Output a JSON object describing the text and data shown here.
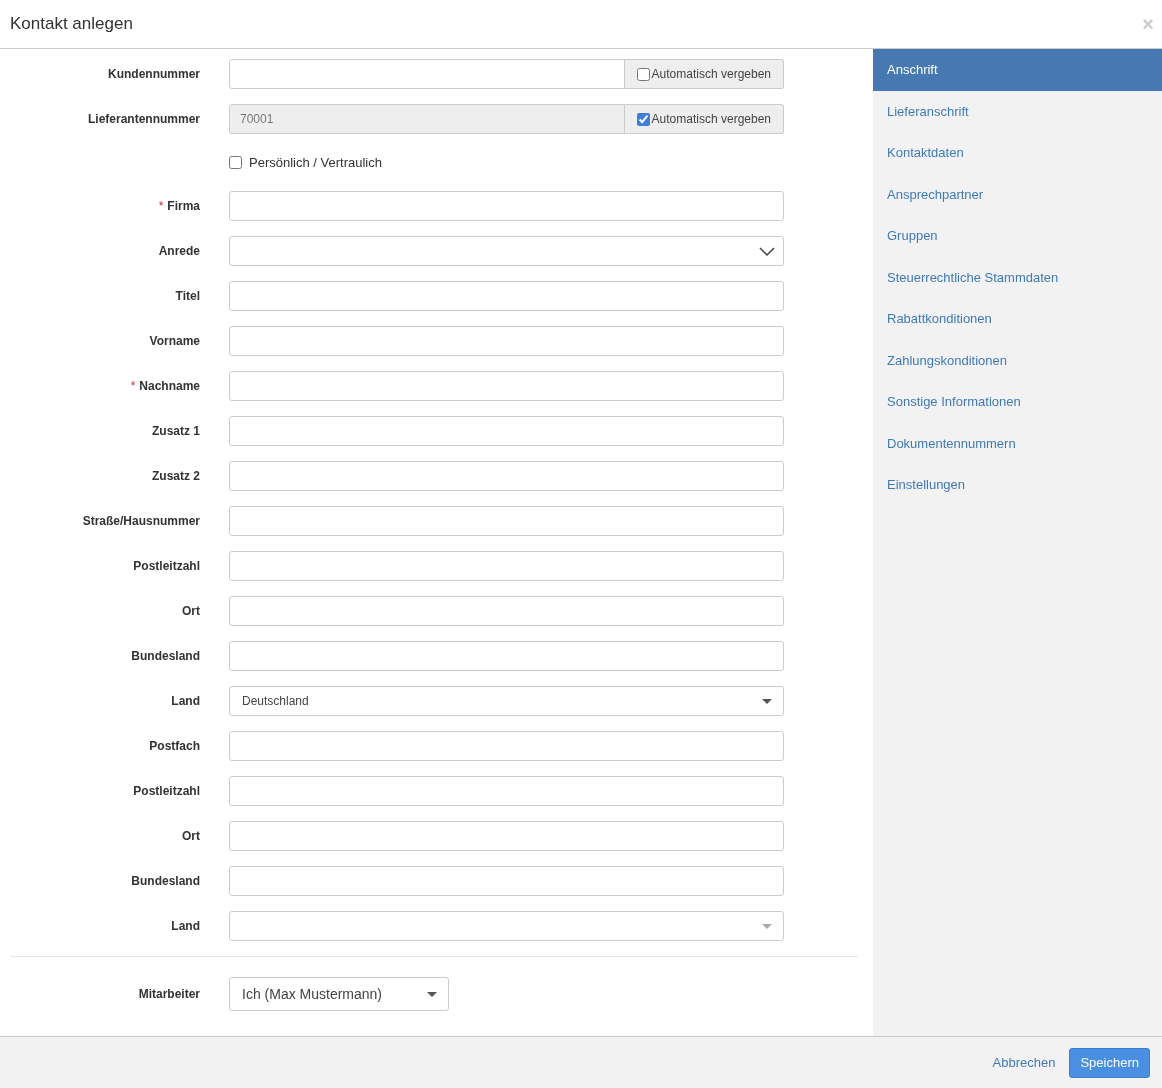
{
  "dialog": {
    "title": "Kontakt anlegen",
    "close": "×"
  },
  "fields": [
    {
      "kind": "addon",
      "label": "Kundennummer",
      "disabled": false,
      "addon": {
        "label": "Automatisch vergeben",
        "checked": false
      }
    },
    {
      "kind": "addon",
      "label": "Lieferantennummer",
      "disabled": true,
      "value": "70001",
      "addon": {
        "label": "Automatisch vergeben",
        "checked": true
      }
    },
    {
      "kind": "checkbox",
      "label": "Persönlich / Vertraulich",
      "checked": false
    },
    {
      "kind": "text",
      "label": "Firma",
      "required_mark": "*"
    },
    {
      "kind": "chevron-select",
      "label": "Anrede"
    },
    {
      "kind": "text",
      "label": "Titel"
    },
    {
      "kind": "text",
      "label": "Vorname"
    },
    {
      "kind": "text",
      "label": "Nachname",
      "required_mark": "*"
    },
    {
      "kind": "text",
      "label": "Zusatz 1"
    },
    {
      "kind": "text",
      "label": "Zusatz 2"
    },
    {
      "kind": "text",
      "label": "Straße/Hausnummer"
    },
    {
      "kind": "text",
      "label": "Postleitzahl"
    },
    {
      "kind": "text",
      "label": "Ort"
    },
    {
      "kind": "text",
      "label": "Bundesland"
    },
    {
      "kind": "select",
      "label": "Land",
      "value": "Deutschland"
    },
    {
      "kind": "text",
      "label": "Postfach"
    },
    {
      "kind": "text",
      "label": "Postleitzahl"
    },
    {
      "kind": "text",
      "label": "Ort"
    },
    {
      "kind": "text",
      "label": "Bundesland"
    },
    {
      "kind": "select",
      "label": "Land"
    }
  ],
  "employee": {
    "label": "Mitarbeiter",
    "value": "Ich (Max Mustermann)"
  },
  "sidebar": {
    "items": [
      {
        "label": "Anschrift",
        "selected": true
      },
      {
        "label": "Lieferanschrift",
        "selected": false
      },
      {
        "label": "Kontaktdaten",
        "selected": false
      },
      {
        "label": "Ansprechpartner",
        "selected": false
      },
      {
        "label": "Gruppen",
        "selected": false
      },
      {
        "label": "Steuerrechtliche Stammdaten",
        "selected": false
      },
      {
        "label": "Rabattkonditionen",
        "selected": false
      },
      {
        "label": "Zahlungskonditionen",
        "selected": false
      },
      {
        "label": "Sonstige Informationen",
        "selected": false
      },
      {
        "label": "Dokumentennummern",
        "selected": false
      },
      {
        "label": "Einstellungen",
        "selected": false
      }
    ]
  },
  "footer": {
    "cancel": "Abbrechen",
    "save": "Speichern"
  }
}
